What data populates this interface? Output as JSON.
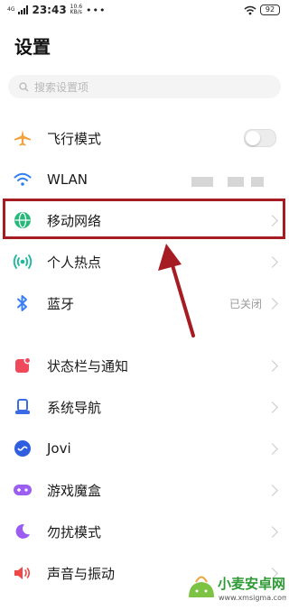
{
  "status_bar": {
    "network": "4G",
    "time": "23:43",
    "speed_value": "10.6",
    "speed_unit": "KB/s",
    "more": "•••",
    "battery": "92"
  },
  "page": {
    "title": "设置"
  },
  "search": {
    "placeholder": "搜索设置项"
  },
  "settings": [
    {
      "id": "airplane",
      "label": "飞行模式",
      "icon": "airplane-icon",
      "color": "#f2a13c",
      "control": "toggle",
      "toggle_on": false
    },
    {
      "id": "wlan",
      "label": "WLAN",
      "icon": "wifi-icon",
      "color": "#2f7ff2",
      "control": "hidden"
    },
    {
      "id": "mobile",
      "label": "移动网络",
      "icon": "globe-icon",
      "color": "#27b97a",
      "control": "chevron"
    },
    {
      "id": "hotspot",
      "label": "个人热点",
      "icon": "hotspot-icon",
      "color": "#22b89d",
      "control": "chevron"
    },
    {
      "id": "bluetooth",
      "label": "蓝牙",
      "icon": "bluetooth-icon",
      "color": "#3a7ff5",
      "control": "value",
      "value": "已关闭"
    },
    {
      "id": "statusbar",
      "label": "状态栏与通知",
      "icon": "statusbar-icon",
      "color": "#ef4a5c",
      "control": "chevron"
    },
    {
      "id": "navigation",
      "label": "系统导航",
      "icon": "navigation-icon",
      "color": "#3b6be6",
      "control": "chevron"
    },
    {
      "id": "jovi",
      "label": "Jovi",
      "icon": "jovi-icon",
      "color": "#2f5fdf",
      "control": "chevron"
    },
    {
      "id": "game",
      "label": "游戏魔盒",
      "icon": "gamepad-icon",
      "color": "#9c5ef0",
      "control": "chevron"
    },
    {
      "id": "dnd",
      "label": "勿扰模式",
      "icon": "moon-icon",
      "color": "#9b5cf2",
      "control": "chevron"
    },
    {
      "id": "sound",
      "label": "声音与振动",
      "icon": "speaker-icon",
      "color": "#ef4848",
      "control": "chevron"
    }
  ],
  "annotation": {
    "color": "#a51c22"
  },
  "watermark": {
    "site_name": "小麦安卓网",
    "url": "www.xmsigma.com"
  }
}
